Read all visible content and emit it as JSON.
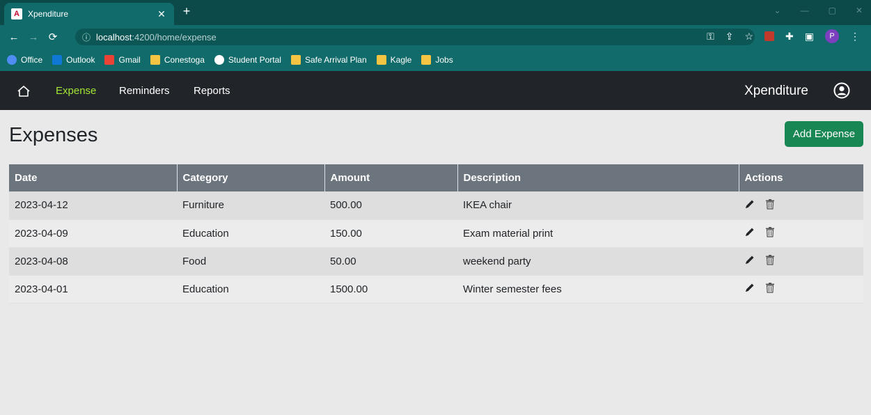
{
  "browser": {
    "tab_title": "Xpenditure",
    "url_host": "localhost",
    "url_path": ":4200/home/expense",
    "profile_initial": "P",
    "bookmarks": [
      {
        "label": "Office",
        "color": "#4f8df5"
      },
      {
        "label": "Outlook",
        "color": "#0f78d4"
      },
      {
        "label": "Gmail",
        "color": "#ea4335"
      },
      {
        "label": "Conestoga",
        "color": "#f6c443"
      },
      {
        "label": "Student Portal",
        "color": "#ffffff"
      },
      {
        "label": "Safe Arrival Plan",
        "color": "#f6c443"
      },
      {
        "label": "Kagle",
        "color": "#f6c443"
      },
      {
        "label": "Jobs",
        "color": "#f6c443"
      }
    ]
  },
  "navbar": {
    "links": [
      "Expense",
      "Reminders",
      "Reports"
    ],
    "brand": "Xpenditure",
    "active_color": "#a3e635"
  },
  "page": {
    "title": "Expenses",
    "add_button": "Add Expense",
    "accent": "#198754"
  },
  "table": {
    "headers": [
      "Date",
      "Category",
      "Amount",
      "Description",
      "Actions"
    ],
    "rows": [
      {
        "date": "2023-04-12",
        "category": "Furniture",
        "amount": "500.00",
        "description": "IKEA chair"
      },
      {
        "date": "2023-04-09",
        "category": "Education",
        "amount": "150.00",
        "description": "Exam material print"
      },
      {
        "date": "2023-04-08",
        "category": "Food",
        "amount": "50.00",
        "description": "weekend party"
      },
      {
        "date": "2023-04-01",
        "category": "Education",
        "amount": "1500.00",
        "description": "Winter semester fees"
      }
    ]
  }
}
